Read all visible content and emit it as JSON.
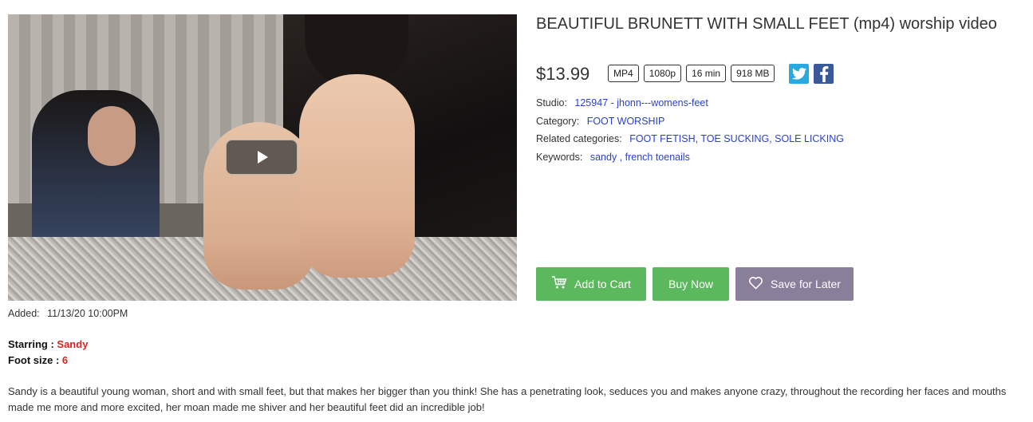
{
  "product": {
    "title": "BEAUTIFUL BRUNETT WITH SMALL FEET (mp4) worship video",
    "price": "$13.99",
    "badges": [
      "MP4",
      "1080p",
      "16 min",
      "918 MB"
    ]
  },
  "social": {
    "twitter_icon": "twitter-icon",
    "facebook_icon": "facebook-icon"
  },
  "meta": {
    "studio_label": "Studio:",
    "studio_value": "125947 - jhonn---womens-feet",
    "category_label": "Category:",
    "category_value": "FOOT WORSHIP",
    "related_label": "Related categories:",
    "related_value": "FOOT FETISH, TOE SUCKING, SOLE LICKING",
    "keywords_label": "Keywords:",
    "keywords_value": "sandy , french toenails"
  },
  "actions": {
    "add_to_cart": "Add to Cart",
    "buy_now": "Buy Now",
    "save_for_later": "Save for Later"
  },
  "added": {
    "label": "Added:",
    "value": "11/13/20 10:00PM"
  },
  "details": {
    "starring_label": "Starring :",
    "starring_value": "Sandy",
    "foot_size_label": "Foot size :",
    "foot_size_value": "6"
  },
  "description": "Sandy is a beautiful young woman, short and with small feet, but that makes her bigger than you think! She has a penetrating look, seduces you and makes anyone crazy, throughout the recording her faces and mouths made me more and more excited, her moan made me shiver and her beautiful feet did an incredible job!",
  "colors": {
    "green": "#5cb85c",
    "purple_gray": "#8a7f9a",
    "link": "#2a3fd0",
    "red": "#d9241c"
  }
}
